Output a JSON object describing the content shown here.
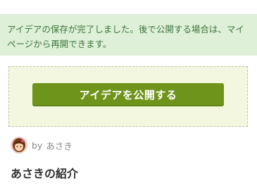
{
  "notice": {
    "message": "アイデアの保存が完了しました。後で公開する場合は、マイページから再開できます。"
  },
  "publish": {
    "button_label": "アイデアを公開する"
  },
  "author": {
    "by_label": "by",
    "name": "あさき",
    "avatar_icon": "avatar-icon"
  },
  "section": {
    "title": "あさきの紹介"
  },
  "colors": {
    "notice_bg": "#dff0d8",
    "notice_text": "#3c763d",
    "button_bg": "#6f941c",
    "box_bg": "#f4f7df"
  }
}
